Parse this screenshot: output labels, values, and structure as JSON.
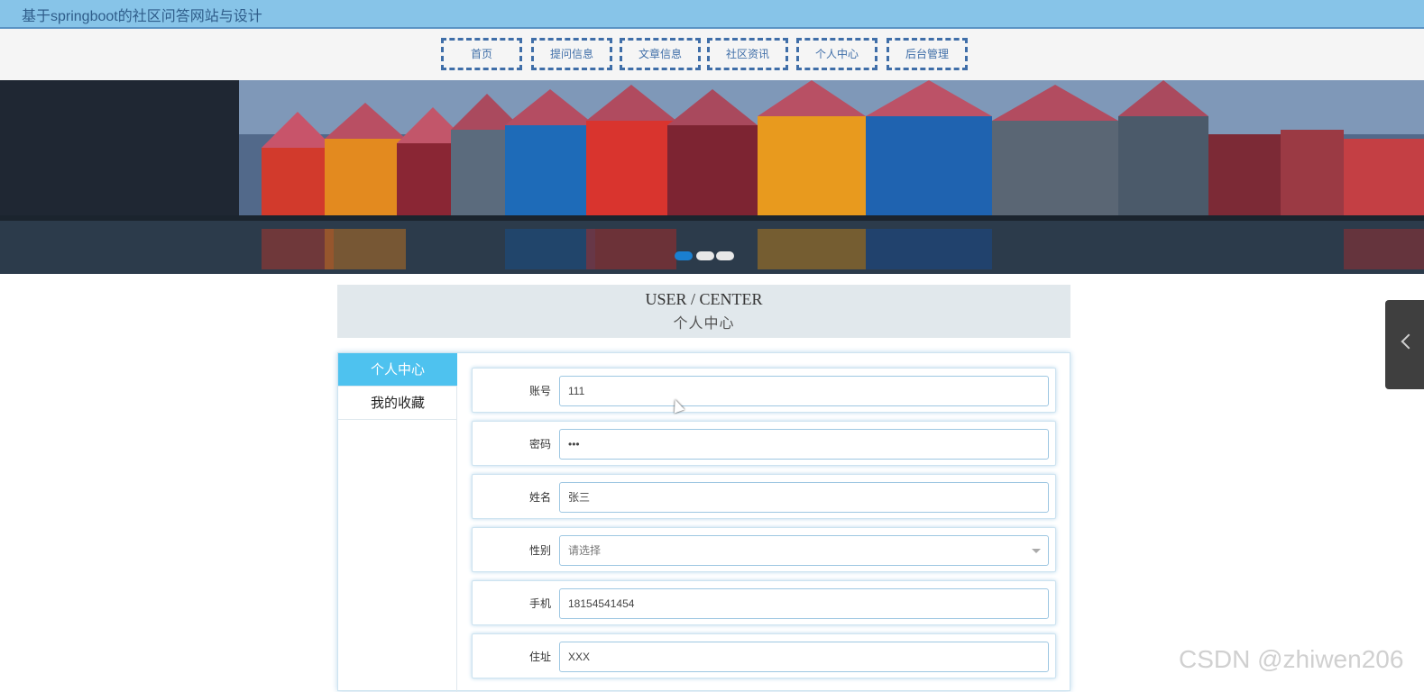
{
  "site_title": "基于springboot的社区问答网站与设计",
  "nav": [
    {
      "label": "首页"
    },
    {
      "label": "提问信息"
    },
    {
      "label": "文章信息"
    },
    {
      "label": "社区资讯"
    },
    {
      "label": "个人中心"
    },
    {
      "label": "后台管理"
    }
  ],
  "carousel": {
    "slide_count": 3,
    "active_index": 0
  },
  "header": {
    "en": "USER / CENTER",
    "cn": "个人中心"
  },
  "sidebar": {
    "items": [
      {
        "label": "个人中心",
        "active": true
      },
      {
        "label": "我的收藏",
        "active": false
      }
    ]
  },
  "form": {
    "fields": [
      {
        "label": "账号",
        "value": "111"
      },
      {
        "label": "密码",
        "value": "•••"
      },
      {
        "label": "姓名",
        "value": "张三"
      },
      {
        "label": "性别",
        "value": "请选择"
      },
      {
        "label": "手机",
        "value": "18154541454"
      },
      {
        "label": "住址",
        "value": "XXX"
      }
    ]
  },
  "watermark": "CSDN @zhiwen206",
  "colors": {
    "topbar": "#87c4e8",
    "accent": "#4ec2ef",
    "nav_border": "#3f6ea8"
  }
}
